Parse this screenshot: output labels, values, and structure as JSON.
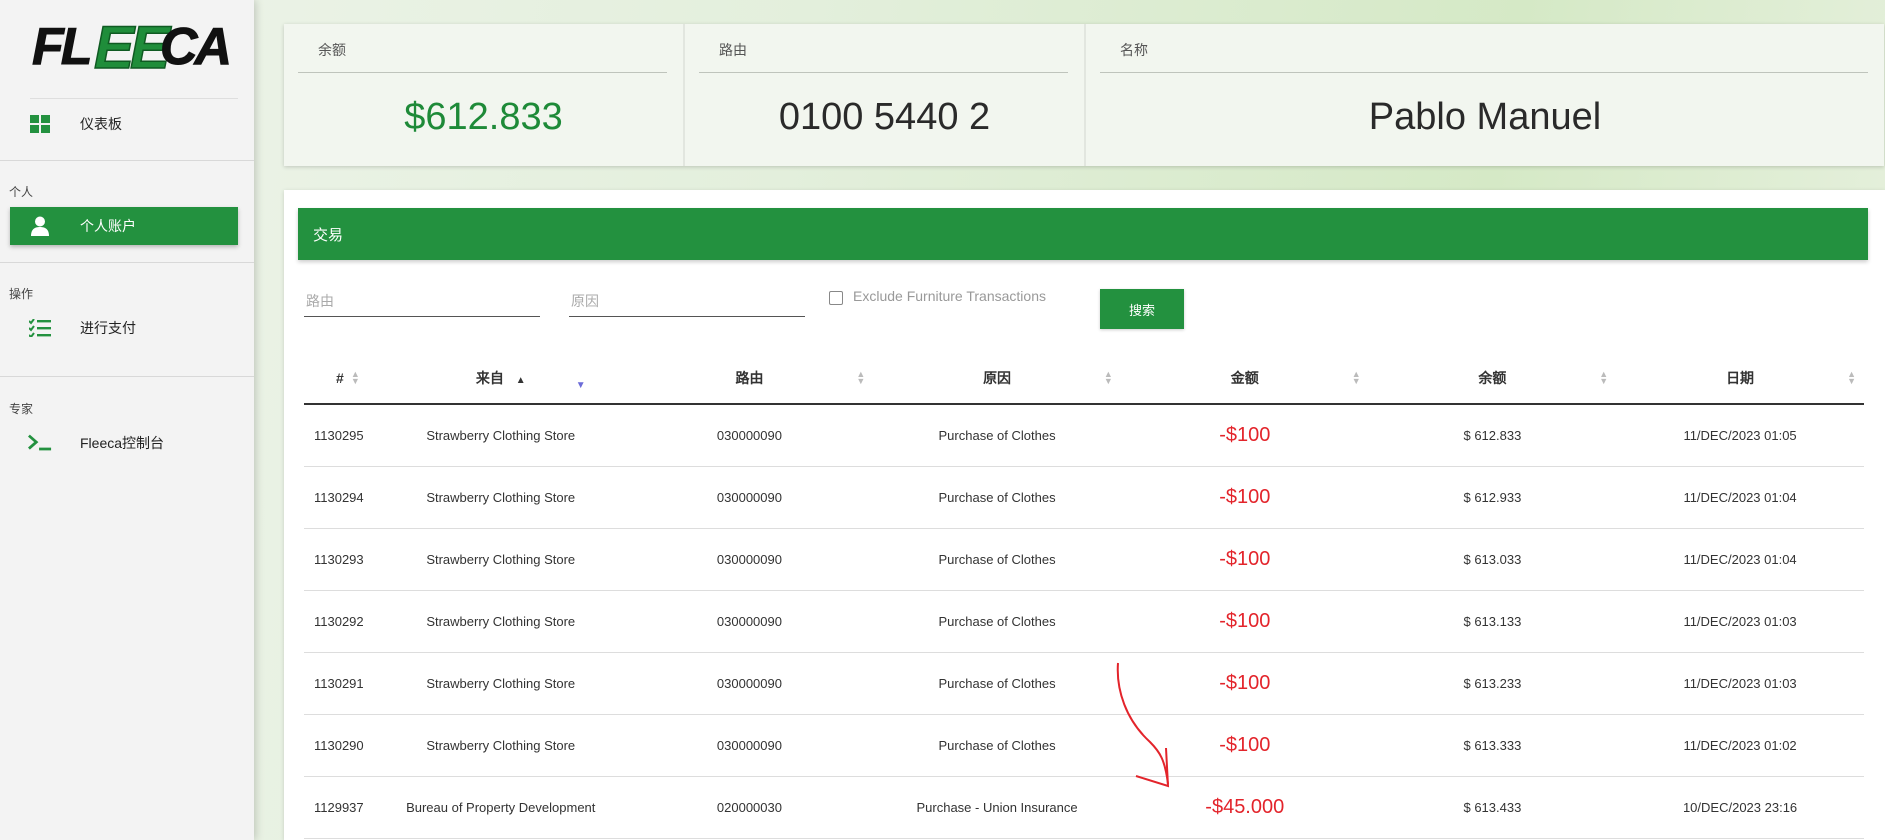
{
  "sidebar": {
    "logo_text": "FLEECA",
    "items": [
      {
        "label": "仪表板",
        "icon": "dashboard-grid-icon"
      },
      {
        "label": "个人账户",
        "icon": "user-icon",
        "active": true
      },
      {
        "label": "进行支付",
        "icon": "list-check-icon"
      },
      {
        "label": "Fleeca控制台",
        "icon": "terminal-icon"
      }
    ],
    "sections": [
      "个人",
      "操作",
      "专家"
    ]
  },
  "cards": {
    "balance": {
      "title": "余额",
      "value": "$612.833"
    },
    "routing": {
      "title": "路由",
      "value": "0100 5440 2"
    },
    "name": {
      "title": "名称",
      "value": "Pablo Manuel"
    }
  },
  "transactions": {
    "header": "交易",
    "filters": {
      "routing_placeholder": "路由",
      "reason_placeholder": "原因",
      "exclude_label": "Exclude Furniture Transactions",
      "search_label": "搜索"
    },
    "columns": [
      "#",
      "来自",
      "路由",
      "原因",
      "金额",
      "余额",
      "日期"
    ],
    "rows": [
      {
        "id": "1130295",
        "from": "Strawberry Clothing Store",
        "routing": "030000090",
        "reason": "Purchase of Clothes",
        "amount": "-$100",
        "balance": "$ 612.833",
        "date": "11/DEC/2023 01:05"
      },
      {
        "id": "1130294",
        "from": "Strawberry Clothing Store",
        "routing": "030000090",
        "reason": "Purchase of Clothes",
        "amount": "-$100",
        "balance": "$ 612.933",
        "date": "11/DEC/2023 01:04"
      },
      {
        "id": "1130293",
        "from": "Strawberry Clothing Store",
        "routing": "030000090",
        "reason": "Purchase of Clothes",
        "amount": "-$100",
        "balance": "$ 613.033",
        "date": "11/DEC/2023 01:04"
      },
      {
        "id": "1130292",
        "from": "Strawberry Clothing Store",
        "routing": "030000090",
        "reason": "Purchase of Clothes",
        "amount": "-$100",
        "balance": "$ 613.133",
        "date": "11/DEC/2023 01:03"
      },
      {
        "id": "1130291",
        "from": "Strawberry Clothing Store",
        "routing": "030000090",
        "reason": "Purchase of Clothes",
        "amount": "-$100",
        "balance": "$ 613.233",
        "date": "11/DEC/2023 01:03"
      },
      {
        "id": "1130290",
        "from": "Strawberry Clothing Store",
        "routing": "030000090",
        "reason": "Purchase of Clothes",
        "amount": "-$100",
        "balance": "$ 613.333",
        "date": "11/DEC/2023 01:02"
      },
      {
        "id": "1129937",
        "from": "Bureau of Property Development",
        "routing": "020000030",
        "reason": "Purchase - Union Insurance",
        "amount": "-$45.000",
        "balance": "$ 613.433",
        "date": "10/DEC/2023 23:16"
      }
    ]
  },
  "colors": {
    "accent": "#23913f",
    "negative": "#e3242b",
    "annotation": "#e3242b"
  }
}
